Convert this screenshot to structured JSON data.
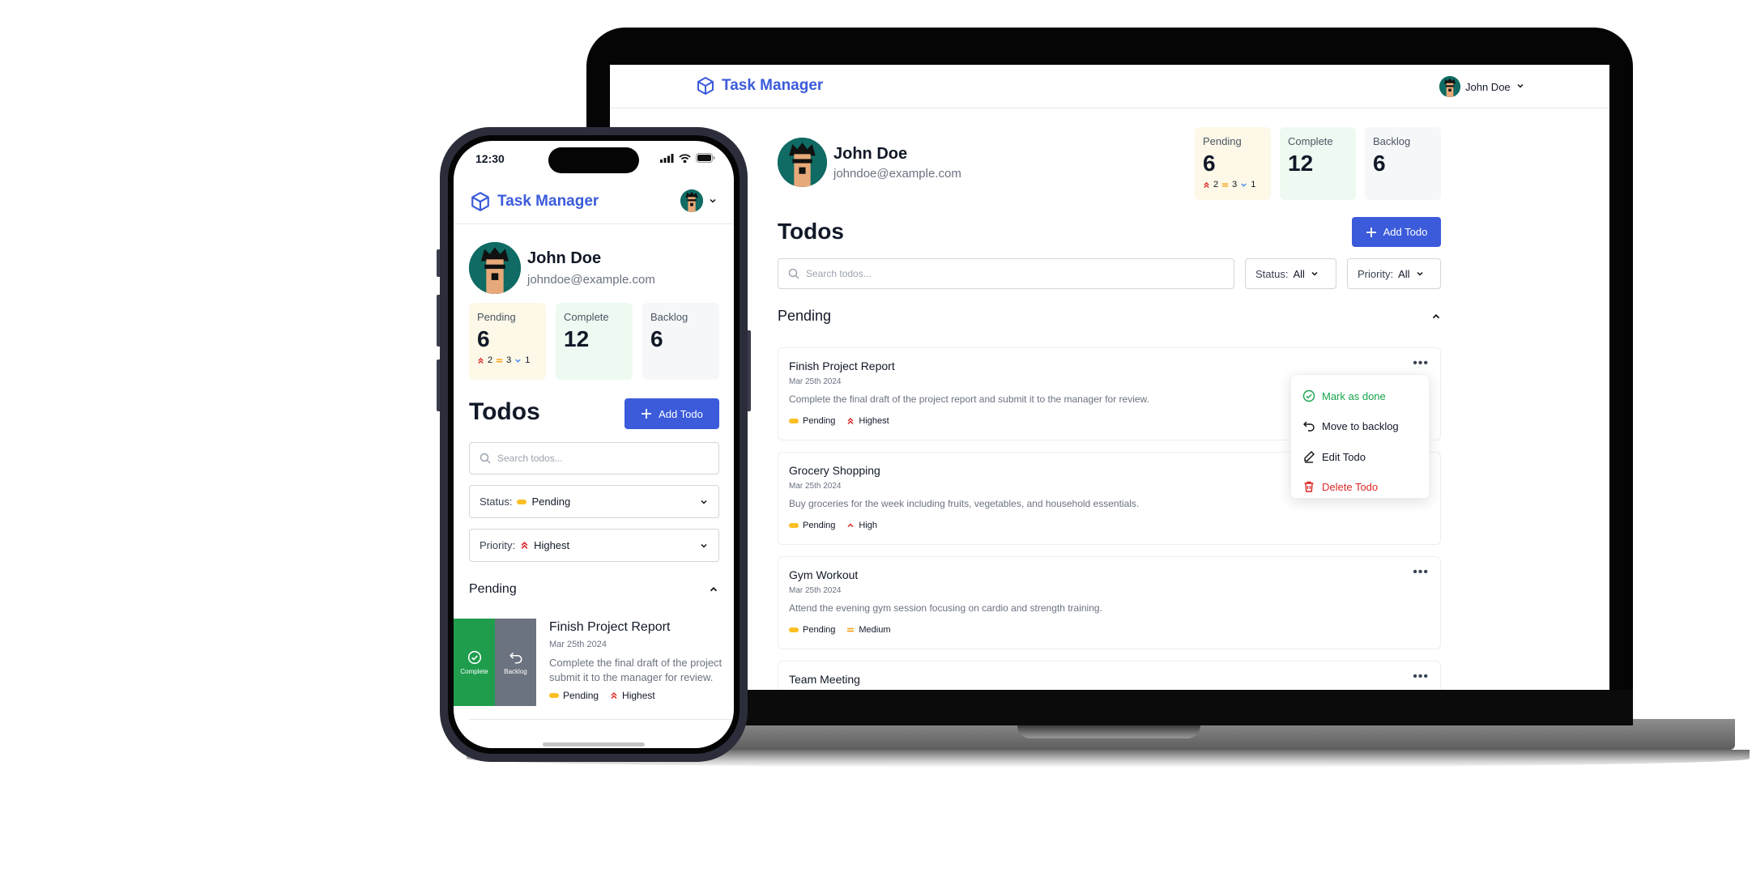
{
  "app": {
    "title": "Task Manager"
  },
  "user": {
    "name": "John Doe",
    "email": "johndoe@example.com"
  },
  "stats": {
    "pending": {
      "label": "Pending",
      "value": "6",
      "highest": "2",
      "medium": "3",
      "low": "1"
    },
    "complete": {
      "label": "Complete",
      "value": "12"
    },
    "backlog": {
      "label": "Backlog",
      "value": "6"
    }
  },
  "todos_heading": "Todos",
  "add_todo_label": "Add Todo",
  "search": {
    "placeholder": "Search todos..."
  },
  "desktop_filters": {
    "status_label": "Status:",
    "status_value": "All",
    "priority_label": "Priority:",
    "priority_value": "All"
  },
  "mobile_filters": {
    "status_label": "Status:",
    "status_value": "Pending",
    "priority_label": "Priority:",
    "priority_value": "Highest"
  },
  "section_title": "Pending",
  "todos": [
    {
      "title": "Finish Project Report",
      "date": "Mar 25th 2024",
      "description": "Complete the final draft of the project report and submit it to the manager for review.",
      "status": "Pending",
      "priority": "Highest"
    },
    {
      "title": "Grocery Shopping",
      "date": "Mar 25th 2024",
      "description": "Buy groceries for the week including fruits, vegetables, and household essentials.",
      "status": "Pending",
      "priority": "High"
    },
    {
      "title": "Gym Workout",
      "date": "Mar 25th 2024",
      "description": "Attend the evening gym session focusing on cardio and strength training.",
      "status": "Pending",
      "priority": "Medium"
    },
    {
      "title": "Team Meeting"
    }
  ],
  "context_menu": {
    "mark_done": "Mark as done",
    "move_backlog": "Move to backlog",
    "edit": "Edit Todo",
    "delete": "Delete Todo"
  },
  "mobile": {
    "time": "12:30",
    "swipe_complete": "Complete",
    "swipe_backlog": "Backlog",
    "card_desc_line1": "Complete the final draft of the project",
    "card_desc_line2": "submit it to the manager for review."
  },
  "colors": {
    "brand": "#3b5bdb",
    "pending": "#fbbf24",
    "success": "#16a34a",
    "danger": "#dc2626",
    "swipe_complete": "#1f9d4d",
    "swipe_backlog": "#6b7280"
  },
  "icons": [
    "cube-icon",
    "chevron-down-icon",
    "chevron-up-icon",
    "plus-icon",
    "search-icon",
    "more-icon",
    "check-circle-icon",
    "undo-icon",
    "pencil-icon",
    "trash-icon",
    "double-chevron-up-icon",
    "chevron-up-small-icon",
    "equals-icon",
    "signal-icon",
    "wifi-icon",
    "battery-icon"
  ]
}
